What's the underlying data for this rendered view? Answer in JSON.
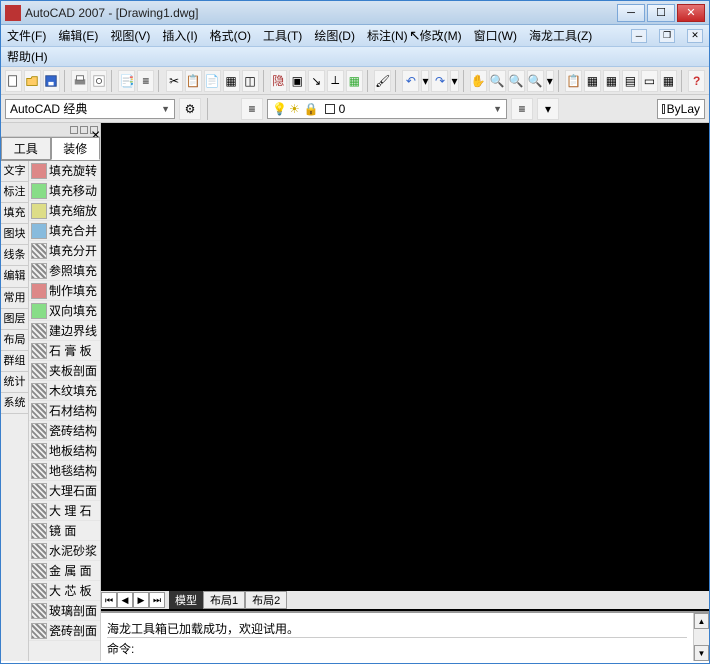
{
  "title": "AutoCAD 2007 - [Drawing1.dwg]",
  "menus": {
    "file": "文件(F)",
    "edit": "编辑(E)",
    "view": "视图(V)",
    "insert": "插入(I)",
    "format": "格式(O)",
    "tools": "工具(T)",
    "draw": "绘图(D)",
    "dimension": "标注(N)",
    "modify": "修改(M)",
    "window": "窗口(W)",
    "hailong": "海龙工具(Z)",
    "help": "帮助(H)"
  },
  "workspace": {
    "label": "AutoCAD 经典"
  },
  "layer": {
    "value": "0",
    "bylayer": "ByLay"
  },
  "left": {
    "tab1": "工具",
    "tab2": "装修",
    "cats": [
      "文字",
      "标注",
      "填充",
      "图块",
      "线条",
      "编辑",
      "常用",
      "图层",
      "布局",
      "群组",
      "统计",
      "系统"
    ],
    "items": [
      "填充旋转",
      "填充移动",
      "填充缩放",
      "填充合并",
      "填充分开",
      "参照填充",
      "制作填充",
      "双向填充",
      "建边界线",
      "石 膏 板",
      "夹板剖面",
      "木纹填充",
      "石材结构",
      "瓷砖结构",
      "地板结构",
      "地毯结构",
      "大理石面",
      "大 理 石",
      "镜    面",
      "水泥砂浆",
      "金 属 面",
      "大 芯 板",
      "玻璃剖面",
      "瓷砖剖面"
    ]
  },
  "tabs": {
    "model": "模型",
    "layout1": "布局1",
    "layout2": "布局2"
  },
  "cmd": {
    "msg": "海龙工具箱已加载成功，欢迎试用。",
    "prompt": "命令:"
  }
}
